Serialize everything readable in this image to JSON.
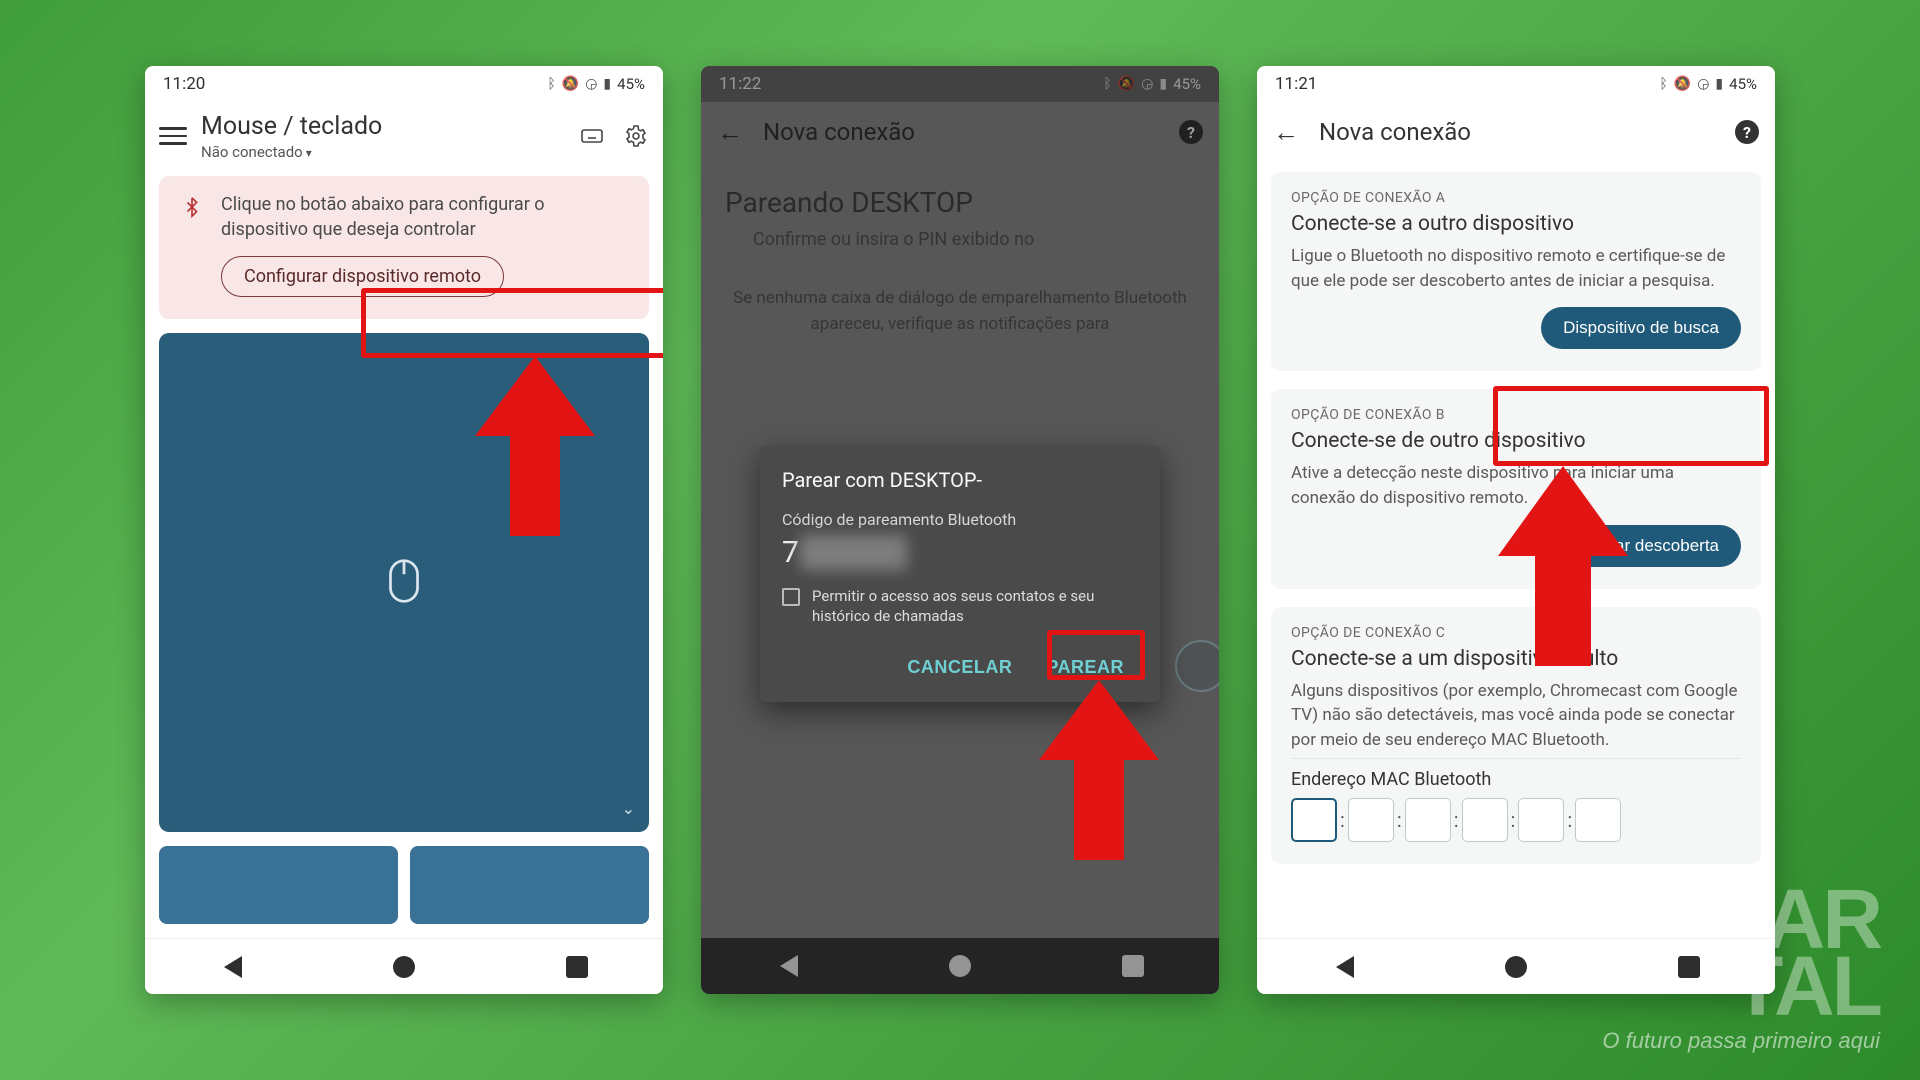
{
  "status": {
    "battery": "45%"
  },
  "p1": {
    "time": "11:20",
    "title": "Mouse / teclado",
    "subtitle": "Não conectado",
    "info_text": "Clique no botão abaixo para configurar o dispositivo que deseja controlar",
    "config_btn": "Configurar dispositivo remoto"
  },
  "p2": {
    "time": "11:22",
    "header": "Nova conexão",
    "pairing_title": "Pareando DESKTOP",
    "pairing_sub": "Confirme ou insira o PIN exibido no",
    "note": "Se nenhuma caixa de diálogo de emparelhamento Bluetooth apareceu, verifique as notificações para",
    "dialog": {
      "title": "Parear com DESKTOP-",
      "sub": "Código de pareamento Bluetooth",
      "code_visible": "7",
      "checkbox": "Permitir o acesso aos seus contatos e seu histórico de chamadas",
      "cancel": "CANCELAR",
      "pair": "PAREAR"
    }
  },
  "p3": {
    "time": "11:21",
    "header": "Nova conexão",
    "optA": {
      "label": "OPÇÃO DE CONEXÃO A",
      "title": "Conecte-se a outro dispositivo",
      "desc": "Ligue o Bluetooth no dispositivo remoto e certifique-se de que ele pode ser descoberto antes de iniciar a pesquisa.",
      "btn": "Dispositivo de busca"
    },
    "optB": {
      "label": "OPÇÃO DE CONEXÃO B",
      "title": "Conecte-se de outro dispositivo",
      "desc": "Ative a detecção neste dispositivo para iniciar uma conexão do dispositivo remoto.",
      "btn": "Ativar descoberta"
    },
    "optC": {
      "label": "OPÇÃO DE CONEXÃO C",
      "title": "Conecte-se a um dispositivo oculto",
      "desc": "Alguns dispositivos (por exemplo, Chromecast com Google TV) não são detectáveis, mas você ainda pode se conectar por meio de seu endereço MAC Bluetooth.",
      "mac_label": "Endereço MAC Bluetooth"
    }
  },
  "watermark": {
    "line1": "AR",
    "line2": "TAL",
    "sub": "O futuro passa primeiro aqui"
  }
}
